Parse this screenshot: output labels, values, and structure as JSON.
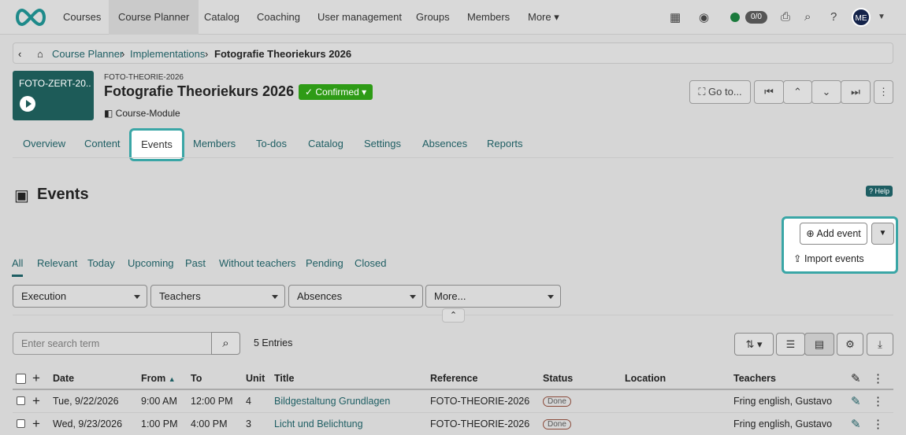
{
  "nav": {
    "items": [
      "Courses",
      "Course Planner",
      "Catalog",
      "Coaching",
      "User management",
      "Groups",
      "Members",
      "More"
    ],
    "online": "0/0",
    "avatar": "ME"
  },
  "breadcrumb": {
    "items": [
      "Course Planner",
      "Implementations",
      "Fotografie Theoriekurs 2026"
    ]
  },
  "course": {
    "thumb_title": "FOTO-ZERT-20...",
    "ref": "FOTO-THEORIE-2026",
    "title": "Fotografie Theoriekurs 2026",
    "status": "Confirmed",
    "type": "Course-Module",
    "goto": "Go to..."
  },
  "tabs": [
    "Overview",
    "Content",
    "Events",
    "Members",
    "To-dos",
    "Catalog",
    "Settings",
    "Absences",
    "Reports"
  ],
  "page": {
    "title": "Events",
    "help": "Help",
    "add_event": "Add event",
    "import": "Import events"
  },
  "filter_tabs": [
    "All",
    "Relevant",
    "Today",
    "Upcoming",
    "Past",
    "Without teachers",
    "Pending",
    "Closed"
  ],
  "filters": [
    "Execution",
    "Teachers",
    "Absences",
    "More..."
  ],
  "search": {
    "placeholder": "Enter search term",
    "entries": "5 Entries"
  },
  "table": {
    "headers": [
      "Date",
      "From",
      "To",
      "Unit",
      "Title",
      "Reference",
      "Status",
      "Location",
      "Teachers"
    ],
    "rows": [
      [
        "Tue, 9/22/2026",
        "9:00 AM",
        "12:00 PM",
        "4",
        "Bildgestaltung Grundlagen",
        "FOTO-THEORIE-2026",
        "Done",
        "",
        "Fring english, Gustavo"
      ],
      [
        "Wed, 9/23/2026",
        "1:00 PM",
        "4:00 PM",
        "3",
        "Licht und Belichtung",
        "FOTO-THEORIE-2026",
        "Done",
        "",
        "Fring english, Gustavo"
      ]
    ]
  },
  "colors": {
    "accent": "#1e5e63",
    "confirmed": "#2e9b16",
    "highlight": "#3aa6a6"
  }
}
